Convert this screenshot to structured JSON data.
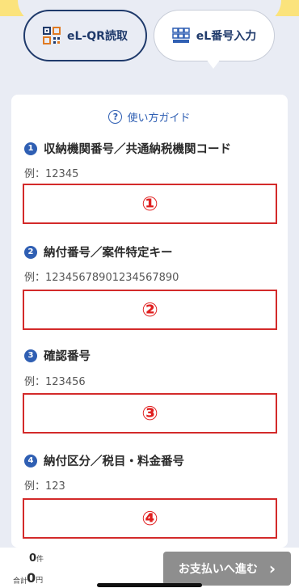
{
  "tabs": {
    "qr_label": "eL-QR読取",
    "number_label": "eL番号入力"
  },
  "guide": {
    "label": "使い方ガイド"
  },
  "fields": [
    {
      "badge": "1",
      "label": "収納機関番号／共通納税機関コード",
      "example": "例：12345",
      "marker": "①"
    },
    {
      "badge": "2",
      "label": "納付番号／案件特定キー",
      "example": "例：12345678901234567890",
      "marker": "②"
    },
    {
      "badge": "3",
      "label": "確認番号",
      "example": "例：123456",
      "marker": "③"
    },
    {
      "badge": "4",
      "label": "納付区分／税目・料金番号",
      "example": "例：123",
      "marker": "④"
    }
  ],
  "footer": {
    "count": "0",
    "count_unit": "件",
    "total_label": "合計",
    "total": "0",
    "total_unit": "円",
    "pay_label": "お支払いへ進む",
    "pay_arrow": "›"
  },
  "colors": {
    "accent": "#2f5fb3",
    "marker_red": "#e02020",
    "button_gray": "#8e8e8e",
    "top_band": "#fbe37c"
  }
}
